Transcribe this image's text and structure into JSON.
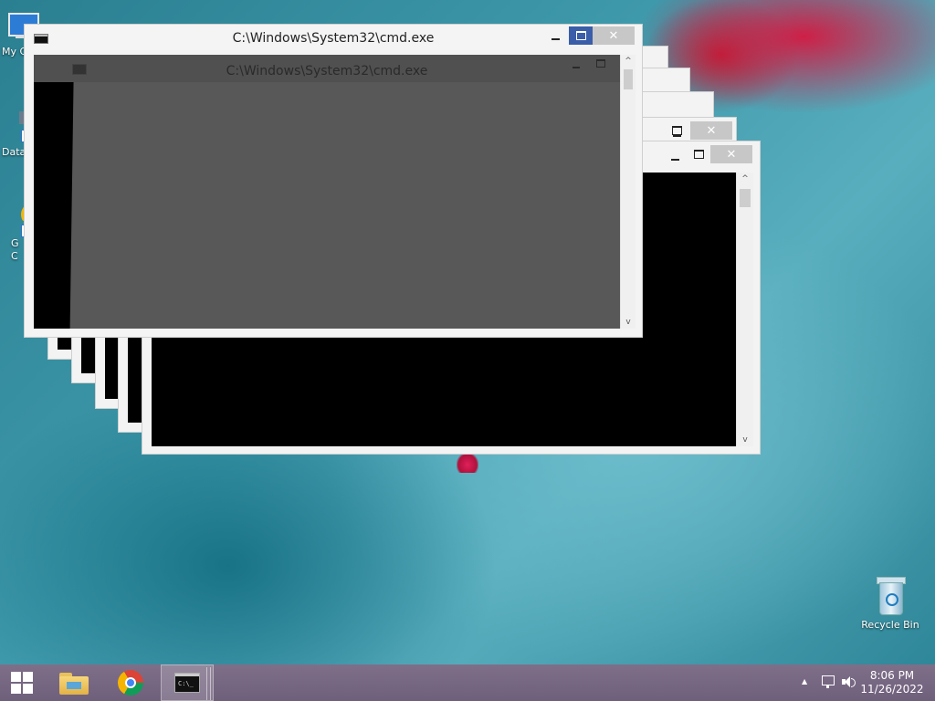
{
  "desktop": {
    "icons_left": [
      {
        "label": "My C"
      },
      {
        "label": "Data"
      },
      {
        "label": "G\nC"
      }
    ],
    "recycle_bin_label": "Recycle Bin"
  },
  "windows": {
    "title": "C:\\Windows\\System32\\cmd.exe",
    "close_glyph": "✕",
    "scroll_up": "^",
    "scroll_down": "v"
  },
  "taskbar": {
    "clock_time": "8:06 PM",
    "clock_date": "11/26/2022",
    "tray_chevron": "▲",
    "pinned": [
      "file-explorer",
      "chrome",
      "cmd"
    ]
  },
  "colors": {
    "active_max_button": "#3a5ea8",
    "close_button": "#c7c7c7",
    "taskbar": "#7f6f89"
  }
}
